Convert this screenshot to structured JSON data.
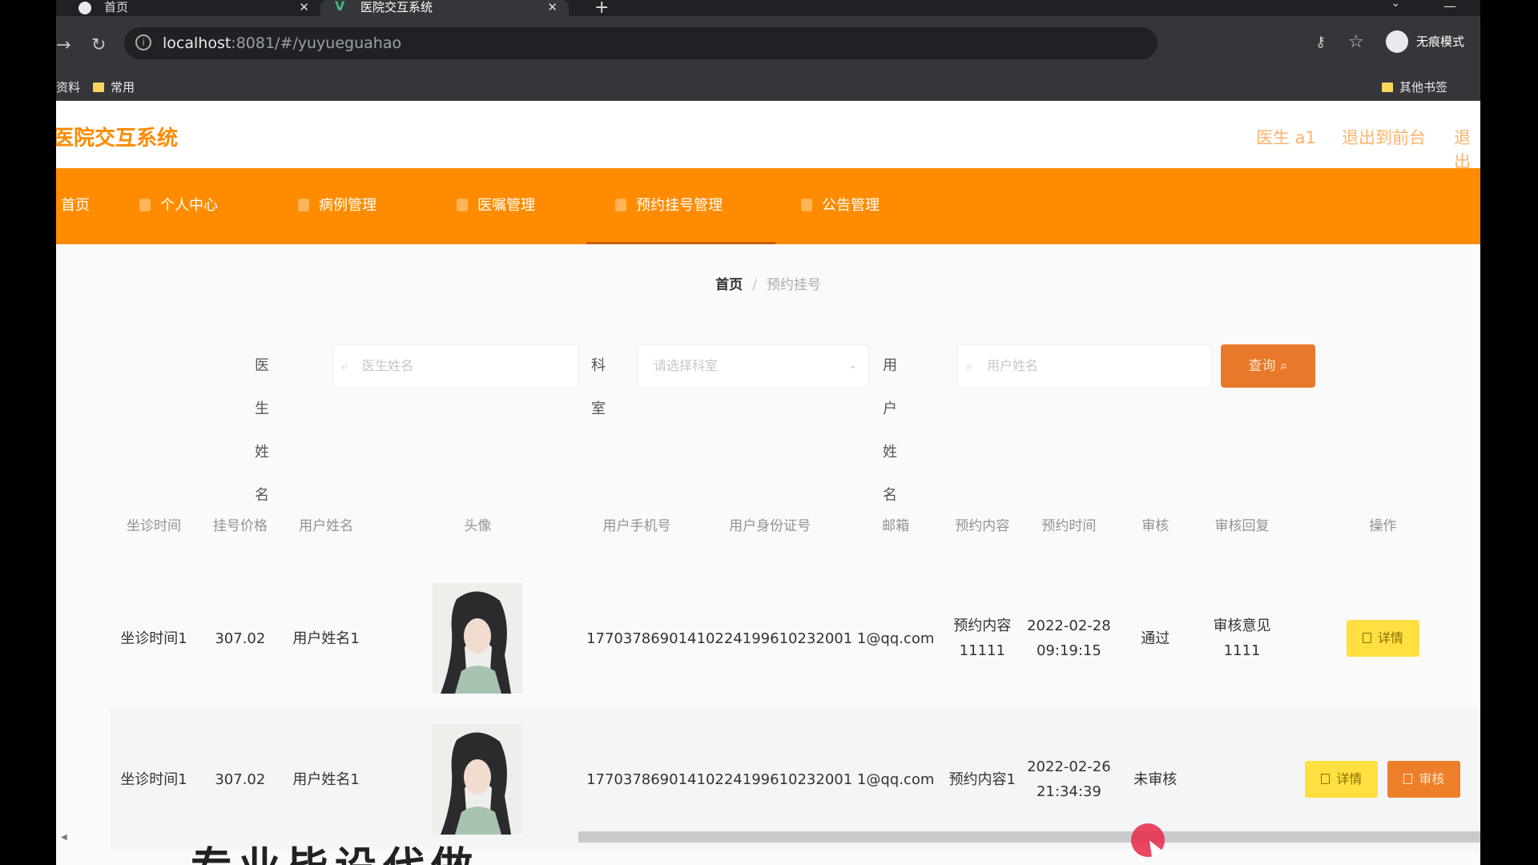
{
  "browser": {
    "tabs": [
      {
        "title": "首页",
        "active": false
      },
      {
        "title": "医院交互系统",
        "active": true
      }
    ],
    "url_host": "localhost",
    "url_rest": ":8081/#/yuyueguahao",
    "profile_label": "无痕模式",
    "bookmarks": [
      "资料",
      "常用"
    ],
    "other_bookmarks": "其他书签"
  },
  "app": {
    "title": "医院交互系统",
    "user_label": "医生 a1",
    "backend_link": "退出到前台",
    "logout_link": "退出"
  },
  "menu": [
    {
      "label": "首页",
      "active": false
    },
    {
      "label": "个人中心",
      "active": false
    },
    {
      "label": "病例管理",
      "active": false
    },
    {
      "label": "医嘱管理",
      "active": false
    },
    {
      "label": "预约挂号管理",
      "active": true
    },
    {
      "label": "公告管理",
      "active": false
    }
  ],
  "breadcrumb": {
    "home": "首页",
    "current": "预约挂号"
  },
  "search": {
    "doctor_label": "医生姓名",
    "doctor_placeholder": "医生姓名",
    "dept_label": "科室",
    "dept_placeholder": "请选择科室",
    "user_label": "用户姓名",
    "user_placeholder": "用户姓名",
    "query_button": "查询"
  },
  "table": {
    "headers": [
      "坐诊时间",
      "挂号价格",
      "用户姓名",
      "头像",
      "用户手机号",
      "用户身份证号",
      "邮箱",
      "预约内容",
      "预约时间",
      "审核",
      "审核回复",
      "操作"
    ],
    "rows": [
      {
        "time": "坐诊时间1",
        "price": "307.02",
        "user": "用户姓名1",
        "phone": "17703786901",
        "idcard": "410224199610232001",
        "email": "1@qq.com",
        "content": "预约内容11111",
        "appt_time": "2022-02-28 09:19:15",
        "audit": "通过",
        "reply": "审核意见1111",
        "actions": [
          "详情"
        ]
      },
      {
        "time": "坐诊时间1",
        "price": "307.02",
        "user": "用户姓名1",
        "phone": "17703786901",
        "idcard": "410224199610232001",
        "email": "1@qq.com",
        "content": "预约内容1",
        "appt_time": "2022-02-26 21:34:39",
        "audit": "未审核",
        "reply": "",
        "actions": [
          "详情",
          "审核"
        ]
      }
    ]
  },
  "overlay_text": "专业毕设代做",
  "colors": {
    "brand": "#ff8c00",
    "detail_button": "#ffe040",
    "audit_button": "#ee7f2a"
  }
}
